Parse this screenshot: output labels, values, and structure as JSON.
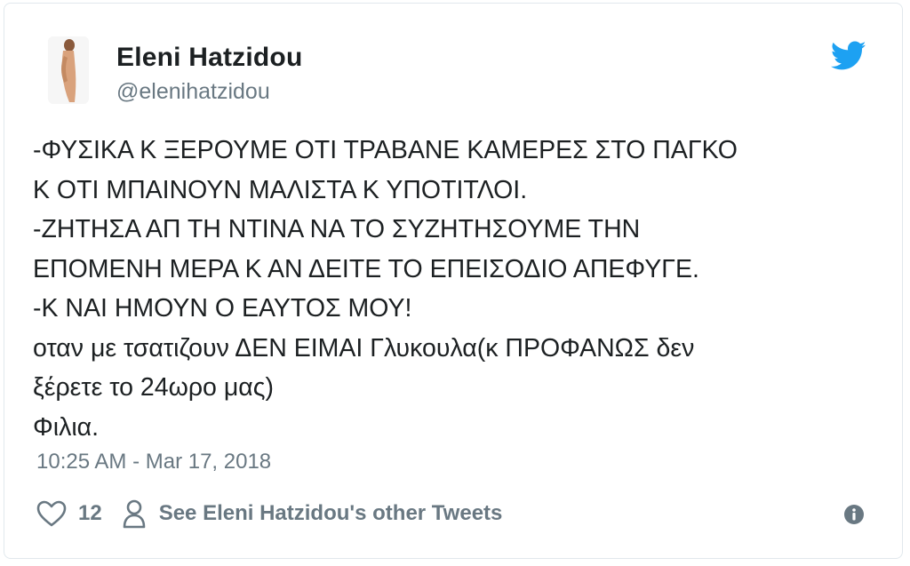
{
  "author": {
    "name": "Eleni Hatzidou",
    "handle": "@elenihatzidou"
  },
  "tweet": {
    "lines": [
      "-ΦΥΣΙΚΑ Κ ΞΕΡΟΥΜΕ ΟΤΙ ΤΡΑΒΑΝΕ ΚΑΜΕΡΕΣ ΣΤΟ ΠΑΓΚΟ",
      "Κ ΟΤΙ ΜΠΑΙΝΟΥΝ ΜΑΛΙΣΤΑ Κ ΥΠΟΤΙΤΛΟΙ.",
      "-ΖΗΤΗΣΑ ΑΠ ΤΗ ΝΤΙΝΑ ΝΑ ΤΟ ΣΥΖΗΤΗΣΟΥΜΕ ΤΗΝ",
      "ΕΠΟΜΕΝΗ ΜΕΡΑ Κ ΑΝ ΔΕΙΤΕ ΤΟ ΕΠΕΙΣΟΔΙΟ ΑΠΕΦΥΓΕ.",
      "-Κ ΝΑΙ ΗΜΟΥΝ Ο ΕΑΥΤΟΣ ΜΟΥ!",
      "οταν με τσατιζουν ΔΕΝ ΕΙΜΑΙ Γλυκουλα(κ ΠΡΟΦΑΝΩΣ δεν",
      "ξέρετε το 24ωρο μας)",
      "Φιλια."
    ],
    "timestamp": "10:25 AM - Mar 17, 2018"
  },
  "actions": {
    "like_count": "12",
    "other_tweets_label": "See Eleni Hatzidou's other Tweets"
  },
  "icons": {
    "brand": "twitter-bird-icon",
    "like": "heart-icon",
    "profile": "person-icon",
    "info": "info-icon"
  },
  "colors": {
    "twitter_blue": "#1da1f2",
    "muted_text": "#697882",
    "primary_text": "#1c2022"
  }
}
